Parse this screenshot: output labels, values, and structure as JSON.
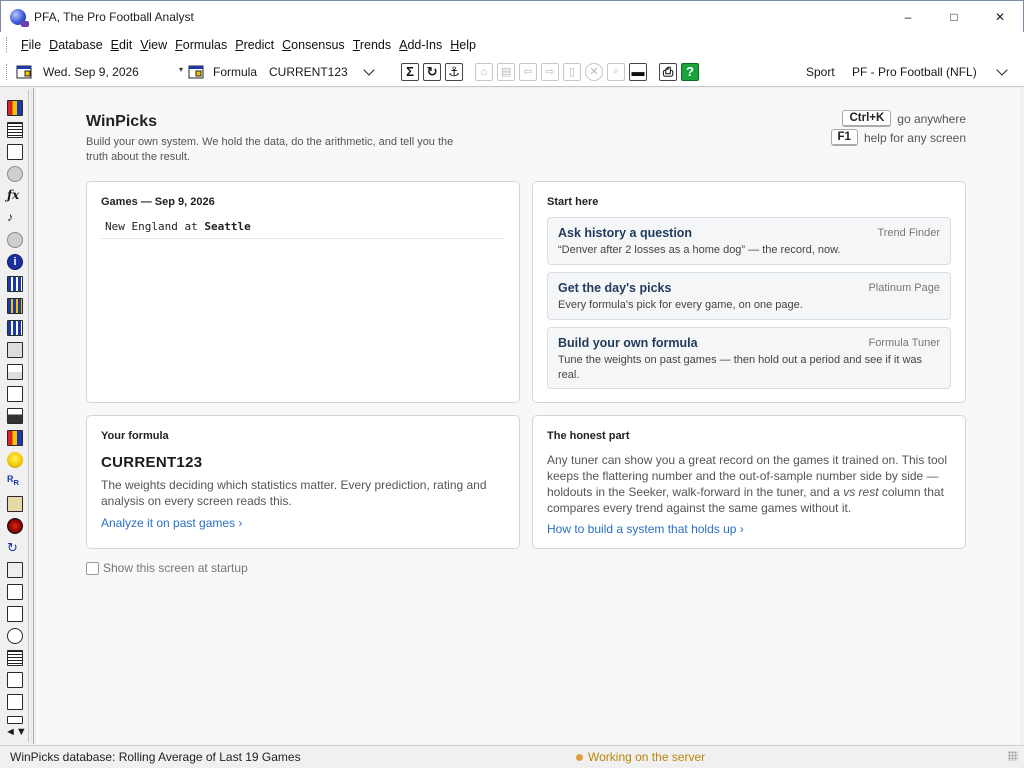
{
  "window": {
    "title": "PFA, The Pro Football Analyst",
    "minimize": "–",
    "maximize": "□",
    "close": "✕"
  },
  "menu": {
    "items": [
      {
        "u": "F",
        "rest": "ile"
      },
      {
        "u": "D",
        "rest": "atabase"
      },
      {
        "u": "E",
        "rest": "dit"
      },
      {
        "u": "V",
        "rest": "iew"
      },
      {
        "u": "F",
        "rest": "ormulas"
      },
      {
        "u": "P",
        "rest": "redict"
      },
      {
        "u": "C",
        "rest": "onsensus"
      },
      {
        "u": "T",
        "rest": "rends"
      },
      {
        "u": "A",
        "rest": "dd-Ins"
      },
      {
        "u": "H",
        "rest": "elp"
      }
    ]
  },
  "toolbar": {
    "date": "Wed. Sep  9, 2026",
    "formula_label": "Formula",
    "formula_value": "CURRENT123",
    "sport_label": "Sport",
    "sport_value": "PF - Pro Football (NFL)"
  },
  "main": {
    "title": "WinPicks",
    "subtitle": "Build your own system. We hold the data, do the arithmetic, and tell you the truth about the result.",
    "shortcuts": [
      {
        "key": "Ctrl+K",
        "text": "go anywhere"
      },
      {
        "key": "F1",
        "text": "help for any screen"
      }
    ],
    "games": {
      "title": "Games — Sep  9, 2026",
      "row_away": "New England at ",
      "row_home": "Seattle"
    },
    "start": {
      "title": "Start here",
      "items": [
        {
          "title": "Ask history a question",
          "tag": "Trend Finder",
          "desc": "“Denver after 2 losses as a home dog” — the record, now."
        },
        {
          "title": "Get the day's picks",
          "tag": "Platinum Page",
          "desc": "Every formula's pick for every game, on one page."
        },
        {
          "title": "Build your own formula",
          "tag": "Formula Tuner",
          "desc": "Tune the weights on past games — then hold out a period and see if it was real."
        }
      ]
    },
    "formula": {
      "title": "Your formula",
      "name": "CURRENT123",
      "desc": "The weights deciding which statistics matter. Every prediction, rating and analysis on every screen reads this.",
      "link": "Analyze it on past games ›"
    },
    "honest": {
      "title": "The honest part",
      "desc_a": "Any tuner can show you a great record on the games it trained on. This tool keeps the flattering number and the out-of-sample number side by side — holdouts in the Seeker, walk-forward in the tuner, and a ",
      "desc_em": "vs rest",
      "desc_b": " column that compares every trend against the same games without it.",
      "link": "How to build a system that holds up ›"
    },
    "startup_label": "Show this screen at startup"
  },
  "status": {
    "database": "WinPicks database:  Rolling Average of Last 19 Games",
    "server": "Working on the server"
  }
}
